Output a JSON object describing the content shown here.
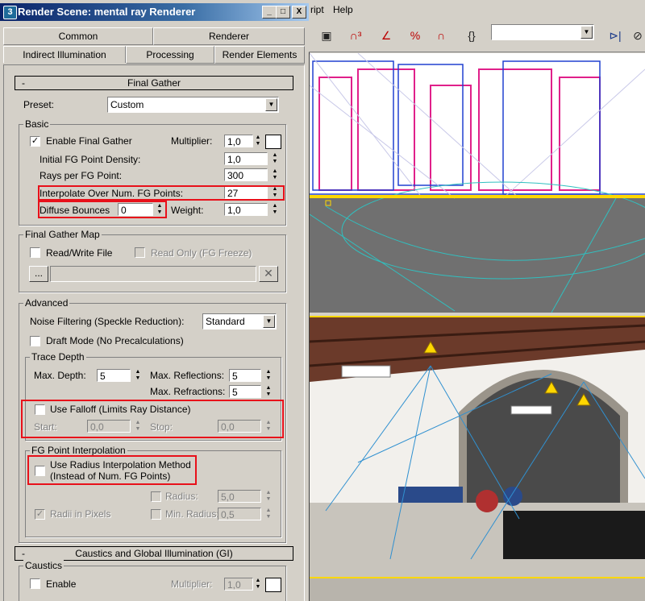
{
  "window": {
    "title": "Render Scene: mental ray Renderer",
    "app_icon": "3",
    "buttons": {
      "minimize": "_",
      "maximize": "□",
      "close": "X"
    }
  },
  "tabs_row1": [
    "Common",
    "Renderer"
  ],
  "tabs_row2": [
    "Indirect Illumination",
    "Processing",
    "Render Elements"
  ],
  "final_gather": {
    "rollout_title": "Final Gather",
    "preset_label": "Preset:",
    "preset_value": "Custom",
    "basic": {
      "group_label": "Basic",
      "enable_label": "Enable Final Gather",
      "enable_checked": "✓",
      "multiplier_label": "Multiplier:",
      "multiplier_value": "1,0",
      "density_label": "Initial FG Point Density:",
      "density_value": "1,0",
      "rays_label": "Rays per FG Point:",
      "rays_value": "300",
      "interpolate_label": "Interpolate Over Num. FG Points:",
      "interpolate_value": "27",
      "bounces_label": "Diffuse Bounces",
      "bounces_value": "0",
      "weight_label": "Weight:",
      "weight_value": "1,0"
    },
    "fg_map": {
      "group_label": "Final Gather Map",
      "readwrite_label": "Read/Write File",
      "readonly_label": "Read Only (FG Freeze)",
      "browse_label": "...",
      "clear_label": "✕"
    },
    "advanced": {
      "group_label": "Advanced",
      "noise_label": "Noise Filtering (Speckle Reduction):",
      "noise_value": "Standard",
      "draft_label": "Draft Mode (No Precalculations)",
      "trace_depth": {
        "group_label": "Trace Depth",
        "max_depth_label": "Max. Depth:",
        "max_depth_value": "5",
        "max_refl_label": "Max. Reflections:",
        "max_refl_value": "5",
        "max_refr_label": "Max. Refractions:",
        "max_refr_value": "5",
        "falloff_label": "Use Falloff (Limits Ray Distance)",
        "start_label": "Start:",
        "start_value": "0,0",
        "stop_label": "Stop:",
        "stop_value": "0,0"
      },
      "fg_interp": {
        "group_label": "FG Point Interpolation",
        "radius_method_label_1": "Use Radius Interpolation Method",
        "radius_method_label_2": "(Instead of Num. FG Points)",
        "radius_label": "Radius:",
        "radius_value": "5,0",
        "radii_pixels_label": "Radii in Pixels",
        "radii_pixels_checked": "✓",
        "min_radius_label": "Min. Radius:",
        "min_radius_value": "0,5"
      }
    }
  },
  "caustics": {
    "rollout_title": "Caustics and Global Illumination (GI)",
    "group_label": "Caustics",
    "enable_label": "Enable",
    "multiplier_label": "Multiplier:",
    "multiplier_value": "1,0"
  },
  "menu": {
    "script": "ript",
    "help": "Help"
  },
  "toolbar_icons": [
    "teapot-icon",
    "snap3-icon",
    "angle-snap-icon",
    "percent-snap-icon",
    "spinner-snap-icon",
    "named-selection-icon",
    "mirror-icon",
    "align-icon"
  ],
  "colors": {
    "highlight": "#e8101a",
    "viewport_border": "#ffd700",
    "title_bar": "#0a246a"
  }
}
